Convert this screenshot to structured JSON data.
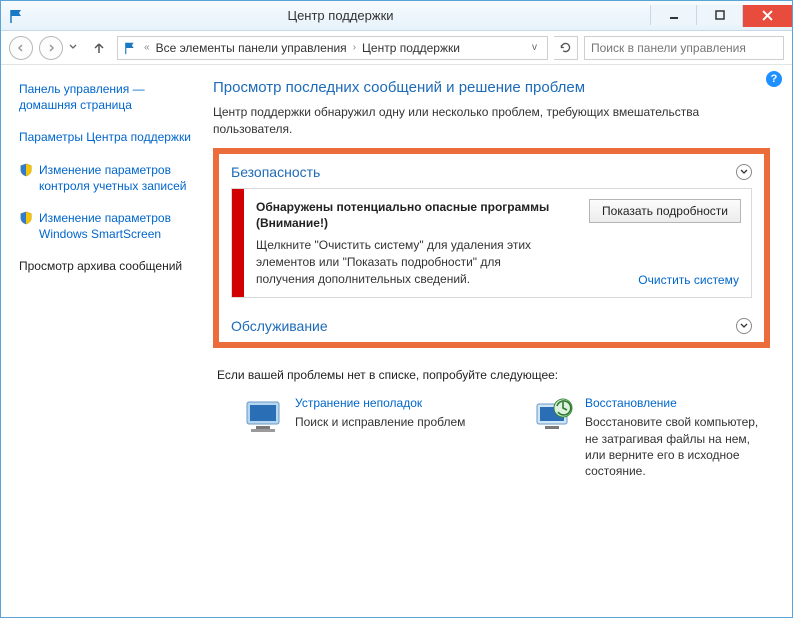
{
  "window": {
    "title": "Центр поддержки",
    "minimize_tooltip": "Свернуть",
    "maximize_tooltip": "Развернуть",
    "close_tooltip": "Закрыть"
  },
  "nav": {
    "breadcrumb_prefix": "«",
    "breadcrumb_item1": "Все элементы панели управления",
    "breadcrumb_item2": "Центр поддержки",
    "search_placeholder": "Поиск в панели управления"
  },
  "sidebar": {
    "links": [
      {
        "label": "Панель управления — домашняя страница",
        "shield": false
      },
      {
        "label": "Параметры Центра поддержки",
        "shield": false
      },
      {
        "label": "Изменение параметров контроля учетных записей",
        "shield": true
      },
      {
        "label": "Изменение параметров Windows SmartScreen",
        "shield": true
      },
      {
        "label": "Просмотр архива сообщений",
        "shield": false,
        "plain": true
      }
    ]
  },
  "main": {
    "title": "Просмотр последних сообщений и решение проблем",
    "subtitle": "Центр поддержки обнаружил одну или несколько проблем, требующих вмешательства пользователя.",
    "sections": {
      "security": {
        "title": "Безопасность"
      },
      "maintenance": {
        "title": "Обслуживание"
      }
    },
    "alert": {
      "title_line1": "Обнаружены потенциально опасные программы",
      "title_line2": "(Внимание!)",
      "description": "Щелкните \"Очистить систему\" для удаления этих элементов или \"Показать подробности\" для получения дополнительных сведений.",
      "details_button": "Показать подробности",
      "clean_link": "Очистить систему"
    },
    "footer_note": "Если вашей проблемы нет в списке, попробуйте следующее:",
    "tiles": [
      {
        "title": "Устранение неполадок",
        "desc": "Поиск и исправление проблем"
      },
      {
        "title": "Восстановление",
        "desc": "Восстановите свой компьютер, не затрагивая файлы на нем, или верните его в исходное состояние."
      }
    ]
  }
}
